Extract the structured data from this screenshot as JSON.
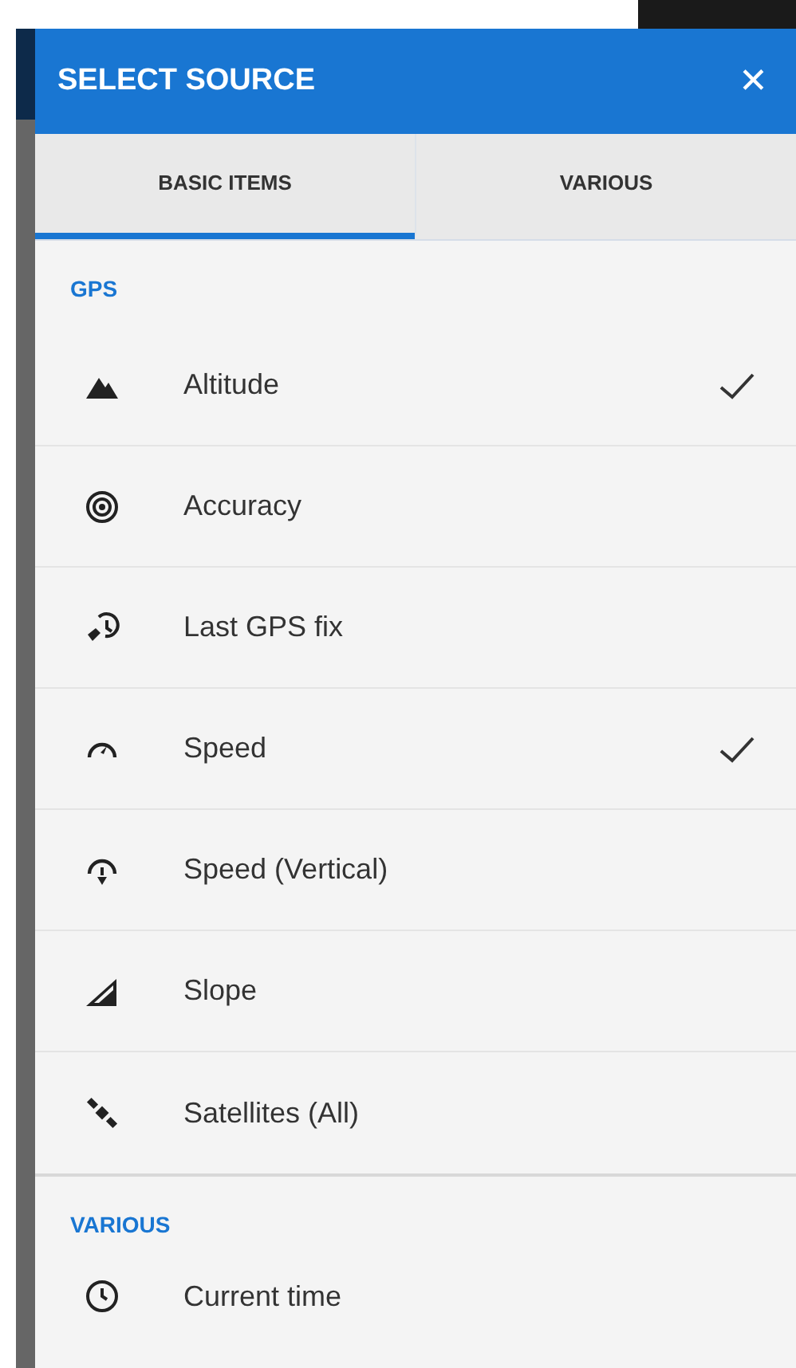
{
  "dialog": {
    "title": "SELECT SOURCE",
    "close": "✕"
  },
  "tabs": [
    {
      "label": "BASIC ITEMS",
      "selected": true
    },
    {
      "label": "VARIOUS",
      "selected": false
    }
  ],
  "sections": [
    {
      "title": "GPS",
      "items": [
        {
          "label": "Altitude",
          "checked": true
        },
        {
          "label": "Accuracy",
          "checked": false
        },
        {
          "label": "Last GPS fix",
          "checked": false
        },
        {
          "label": "Speed",
          "checked": true
        },
        {
          "label": "Speed (Vertical)",
          "checked": false
        },
        {
          "label": "Slope",
          "checked": false
        },
        {
          "label": "Satellites (All)",
          "checked": false
        }
      ]
    },
    {
      "title": "VARIOUS",
      "items": [
        {
          "label": "Current time",
          "checked": false
        }
      ]
    }
  ]
}
